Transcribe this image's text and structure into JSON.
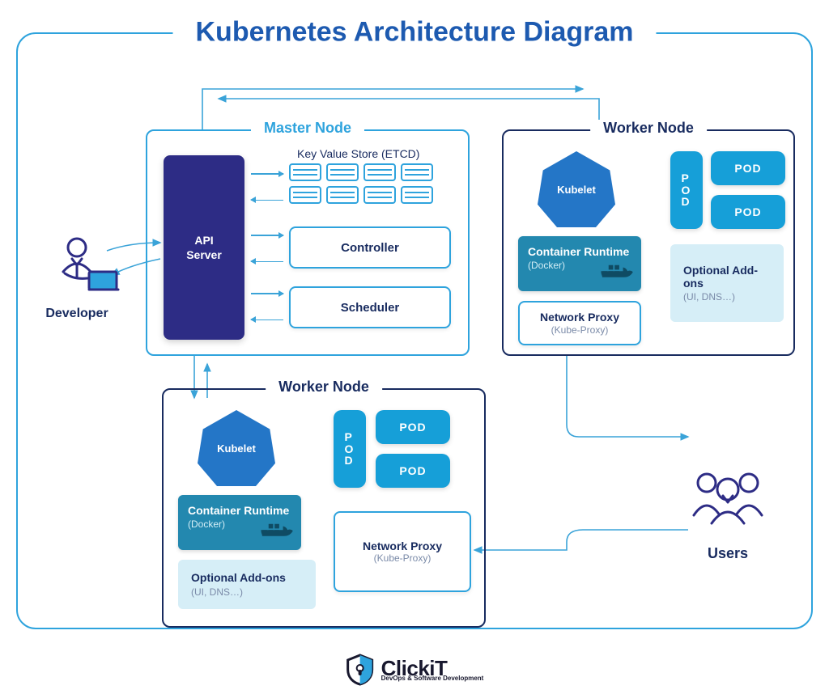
{
  "title": "Kubernetes Architecture Diagram",
  "master": {
    "label": "Master Node",
    "api_server": "API\nServer",
    "etcd_label": "Key Value Store (ETCD)",
    "controller": "Controller",
    "scheduler": "Scheduler"
  },
  "worker": {
    "label": "Worker Node",
    "kubelet": "Kubelet",
    "runtime_title": "Container Runtime",
    "runtime_sub": "(Docker)",
    "netproxy_title": "Network Proxy",
    "netproxy_sub": "(Kube-Proxy)",
    "addons_title": "Optional Add-ons",
    "addons_sub": "(UI, DNS…)",
    "pod": "POD"
  },
  "developer": "Developer",
  "users": "Users",
  "logo": {
    "name": "ClickiT",
    "tagline": "DevOps & Software Development"
  }
}
